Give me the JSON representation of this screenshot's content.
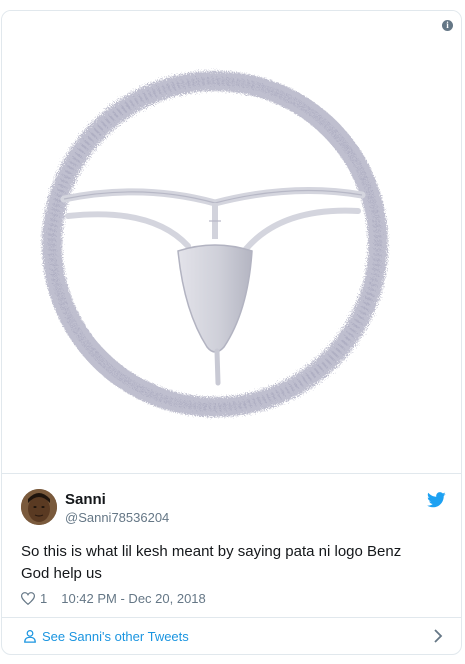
{
  "media": {
    "info_icon": "info-icon",
    "info_glyph": "i"
  },
  "author": {
    "name": "Sanni",
    "handle": "@Sanni78536204"
  },
  "tweet": {
    "text_line1": "So this is what lil kesh meant by saying pata ni logo Benz",
    "text_line2": "God help us",
    "like_count": "1",
    "timestamp": "10:42 PM - Dec 20, 2018"
  },
  "footer": {
    "link_label": "See Sanni's other Tweets"
  },
  "colors": {
    "accent": "#1b95e0",
    "twitter_bird": "#1da1f2",
    "muted": "#657786",
    "border": "#e1e8ed"
  }
}
